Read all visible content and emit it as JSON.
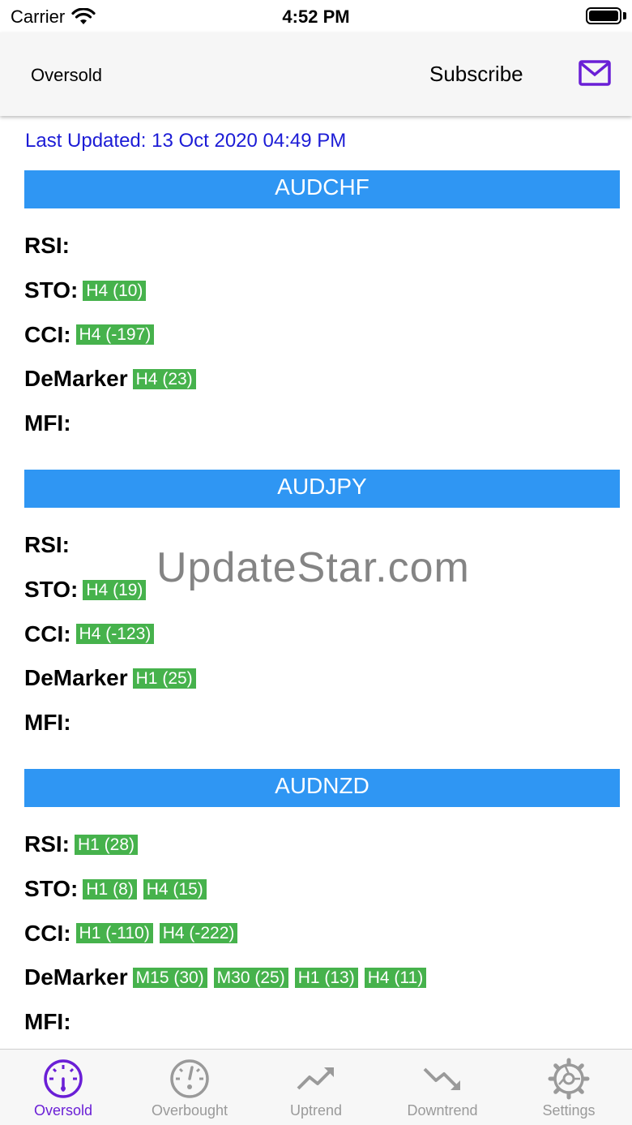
{
  "status_bar": {
    "carrier": "Carrier",
    "time": "4:52 PM"
  },
  "header": {
    "title": "Oversold",
    "subscribe_label": "Subscribe",
    "mail_icon": "mail-icon"
  },
  "last_updated": "Last Updated: 13 Oct 2020 04:49 PM",
  "watermark": "UpdateStar.com",
  "colors": {
    "accent": "#6a1fd6",
    "section_header": "#2f96f3",
    "tag_green": "#46b24c",
    "updated_text": "#1c1cd6"
  },
  "pairs": [
    {
      "name": "AUDCHF",
      "indicators": [
        {
          "label": "RSI:",
          "tags": []
        },
        {
          "label": "STO:",
          "tags": [
            "H4 (10)"
          ]
        },
        {
          "label": "CCI:",
          "tags": [
            "H4 (-197)"
          ]
        },
        {
          "label": "DeMarker",
          "tags": [
            "H4 (23)"
          ]
        },
        {
          "label": "MFI:",
          "tags": []
        }
      ]
    },
    {
      "name": "AUDJPY",
      "indicators": [
        {
          "label": "RSI:",
          "tags": []
        },
        {
          "label": "STO:",
          "tags": [
            "H4 (19)"
          ]
        },
        {
          "label": "CCI:",
          "tags": [
            "H4 (-123)"
          ]
        },
        {
          "label": "DeMarker",
          "tags": [
            "H1 (25)"
          ]
        },
        {
          "label": "MFI:",
          "tags": []
        }
      ]
    },
    {
      "name": "AUDNZD",
      "indicators": [
        {
          "label": "RSI:",
          "tags": [
            "H1 (28)"
          ]
        },
        {
          "label": "STO:",
          "tags": [
            "H1 (8)",
            "H4 (15)"
          ]
        },
        {
          "label": "CCI:",
          "tags": [
            "H1 (-110)",
            "H4 (-222)"
          ]
        },
        {
          "label": "DeMarker",
          "tags": [
            "M15 (30)",
            "M30 (25)",
            "H1 (13)",
            "H4 (11)"
          ]
        },
        {
          "label": "MFI:",
          "tags": []
        }
      ]
    }
  ],
  "tabs": [
    {
      "label": "Oversold",
      "icon": "gauge-low-icon",
      "active": true
    },
    {
      "label": "Overbought",
      "icon": "gauge-high-icon",
      "active": false
    },
    {
      "label": "Uptrend",
      "icon": "trend-up-icon",
      "active": false
    },
    {
      "label": "Downtrend",
      "icon": "trend-down-icon",
      "active": false
    },
    {
      "label": "Settings",
      "icon": "gear-icon",
      "active": false
    }
  ]
}
